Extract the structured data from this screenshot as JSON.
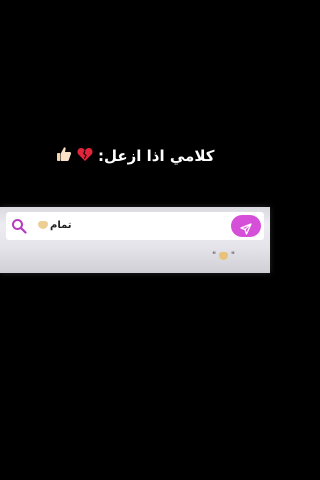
{
  "caption": {
    "text": "كلامي اذا ازعل:",
    "heart_icon": "broken-heart-icon",
    "thumb_icon": "thumbs-up-icon"
  },
  "search": {
    "query": "تمام",
    "query_emoji_icon": "hand-emoji-icon",
    "send_icon": "send-icon",
    "search_icon": "search-icon",
    "accent_color": "#d64fd8"
  },
  "reply_preview": {
    "open_quote": "\"",
    "close_quote": "\"",
    "emoji_icon": "hand-emoji-icon"
  }
}
